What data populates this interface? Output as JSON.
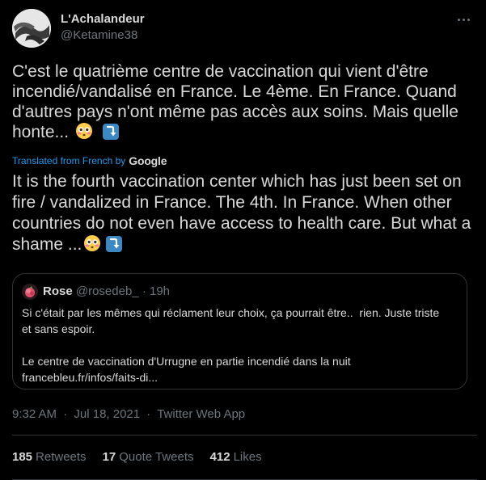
{
  "author": {
    "display_name": "L'Achalandeur",
    "handle": "@Ketamine38"
  },
  "tweet": {
    "original_text": "C'est le quatrième centre de vaccination qui vient d'être incendié/vandalisé en France. Le 4ème. En France. Quand d'autres pays n'ont même pas accès aux soins. Mais quelle honte...",
    "translated_from": "Translated from French by",
    "translator_brand": "Google",
    "translated_text": "It is the fourth vaccination center which has just been set on fire / vandalized in France. The 4th. In France. When other countries do not even have access to health care. But what a shame ...",
    "emojis": [
      "flushed-face",
      "arrow-heading-down"
    ]
  },
  "quote": {
    "name": "Rose",
    "handle": "@rosedeb_",
    "separator": "·",
    "time": "19h",
    "line1": "Si c'était par les mêmes qui réclament leur choix, ça pourrait être..  rien. Juste triste et sans espoir.",
    "line2": "Le centre de vaccination d'Urrugne en partie incendié dans la nuit",
    "link": "francebleu.fr/infos/faits-di..."
  },
  "meta": {
    "time": "9:32 AM",
    "separator": "·",
    "date": "Jul 18, 2021",
    "source": "Twitter Web App"
  },
  "stats": {
    "retweets_count": "185",
    "retweets_label": "Retweets",
    "quote_count": "17",
    "quote_label": "Quote Tweets",
    "likes_count": "412",
    "likes_label": "Likes"
  },
  "colors": {
    "background": "#000000",
    "text": "#d9d9d9",
    "secondary": "#6e767d",
    "accent": "#1d9bf0",
    "border": "#2f3336"
  }
}
